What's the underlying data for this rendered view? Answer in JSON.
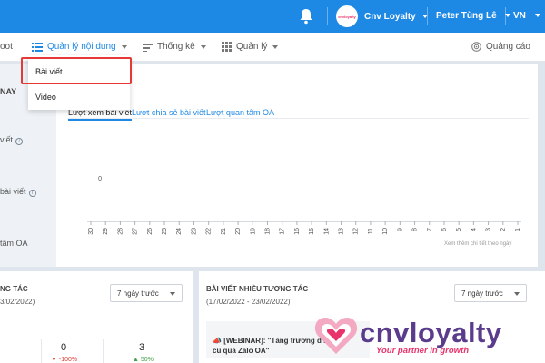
{
  "topbar": {
    "bell_icon": "bell-icon",
    "brand_logo_text": "cnvloyalty",
    "brand_name": "Cnv Loyalty",
    "user_name": "Peter Tùng Lê",
    "language": "VN"
  },
  "nav": {
    "items": [
      {
        "label": "oot",
        "icon": ""
      },
      {
        "label": "Quản lý nội dung",
        "icon": "list-icon"
      },
      {
        "label": "Thống kê",
        "icon": "bar-chart-icon"
      },
      {
        "label": "Quản lý",
        "icon": "grid-icon"
      }
    ],
    "ads_label": "Quảng cáo",
    "ads_icon": "target-icon"
  },
  "dropdown": {
    "items": [
      "Bài viết",
      "Video"
    ]
  },
  "side_labels": [
    "NAY",
    "viết",
    "bài viết",
    "tâm OA"
  ],
  "chart_tabs": [
    "Lượt xem bài viết",
    "Lượt chia sẻ bài viết",
    "Lượt quan tâm OA"
  ],
  "chart_data": {
    "type": "line",
    "categories": [
      "30",
      "29",
      "28",
      "27",
      "26",
      "25",
      "24",
      "23",
      "22",
      "21",
      "20",
      "19",
      "18",
      "17",
      "16",
      "15",
      "14",
      "13",
      "12",
      "11",
      "10",
      "9",
      "8",
      "7",
      "6",
      "5",
      "4",
      "3",
      "2",
      "1"
    ],
    "series": [
      {
        "values": [
          0,
          0,
          0,
          0,
          0,
          0,
          0,
          0,
          0,
          0,
          0,
          0,
          0,
          0,
          0,
          0,
          0,
          0,
          0,
          0,
          0,
          0,
          0,
          0,
          0,
          0,
          0,
          0,
          0,
          0
        ]
      }
    ],
    "y_ticks": [
      "0"
    ],
    "title": "",
    "xlabel": "",
    "ylabel": "",
    "grid": false,
    "note": "Xem thêm chi tiết theo ngày"
  },
  "bottom_left": {
    "title": "NG TÁC",
    "date_range": "3/02/2022)",
    "filter": "7 ngày trước",
    "stats": [
      {
        "value": "0",
        "delta": "-100%",
        "dir": "down"
      },
      {
        "value": "3",
        "delta": "50%",
        "dir": "up"
      }
    ]
  },
  "bottom_right": {
    "title": "BÀI VIẾT NHIỀU TƯƠNG TÁC",
    "date_range": "(17/02/2022 - 23/02/2022)",
    "filter": "7 ngày trước",
    "post_line1": "[WEBINAR]: \"Tăng trưởng d",
    "post_line1_tail": "nhá",
    "post_line2": "cũ qua Zalo OA\"",
    "post_icon": "announcement-icon"
  },
  "watermark": {
    "logo_icon": "heart-logo-icon",
    "wordmark": "cnvloyalty",
    "tagline": "Your partner in growth"
  },
  "colors": {
    "primary": "#1e88e5",
    "highlight": "#e53935",
    "brand_purple": "#5a3b8c",
    "brand_pink": "#e8336b"
  }
}
